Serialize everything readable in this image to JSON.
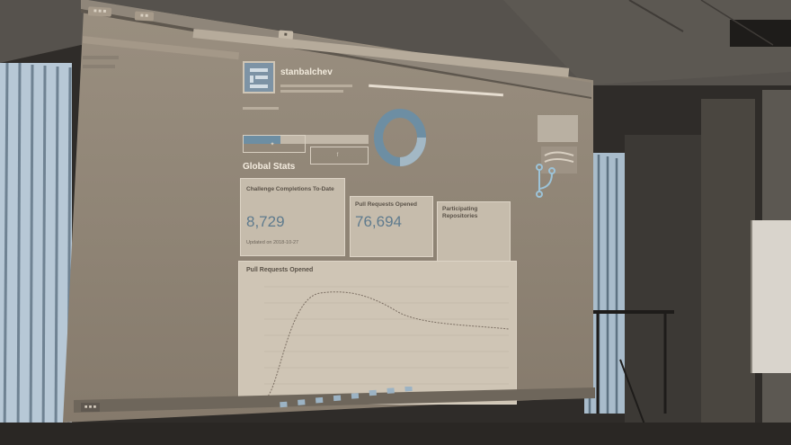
{
  "profile": {
    "username": "stanbalchev",
    "subtitle": "",
    "progress_label": "",
    "completion_note": ""
  },
  "share_buttons": [
    {
      "label": "",
      "icon": "twitter-icon"
    },
    {
      "label": "",
      "icon": "facebook-icon"
    }
  ],
  "global_stats": {
    "heading": "Global Stats",
    "cards": [
      {
        "title": "Challenge Completions To-Date",
        "value": "8,729",
        "sub": "Updated on 2018-10-27"
      },
      {
        "title": "Pull Requests Opened",
        "value": "76,694",
        "sub": ""
      },
      {
        "title": "Participating Repositories",
        "value": "",
        "sub": ""
      }
    ]
  },
  "chart": {
    "title": "Pull Requests Opened"
  },
  "colors": {
    "accent": "#6d8ea3",
    "screen_bg": "#8e8374",
    "card_bg": "#c6bcac",
    "value_color": "#5f7b8e"
  }
}
